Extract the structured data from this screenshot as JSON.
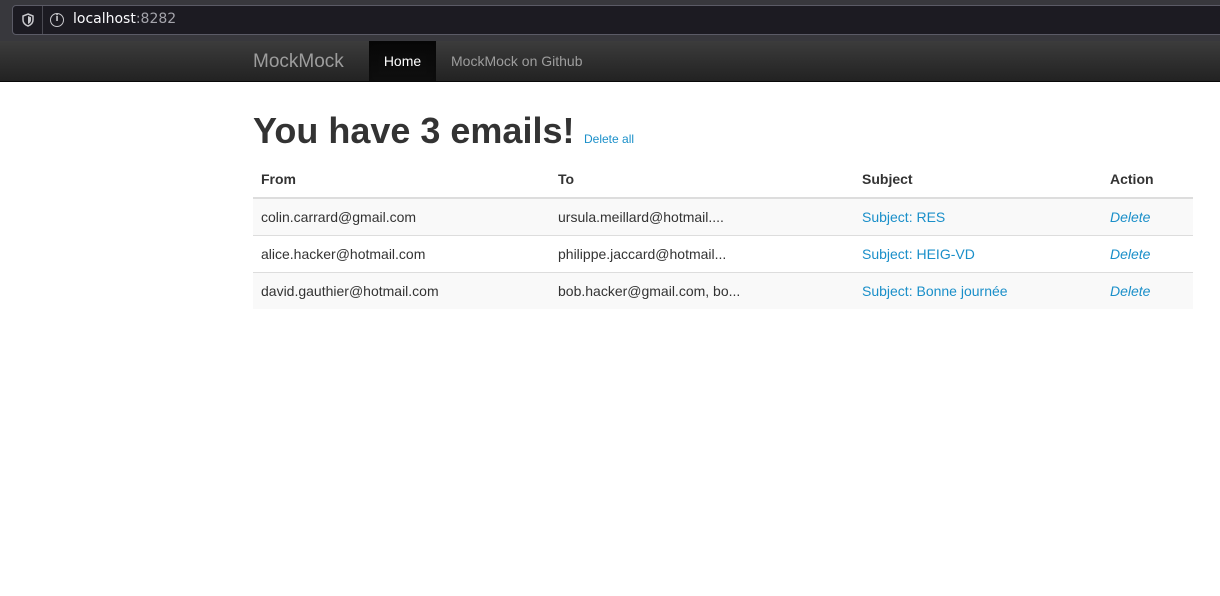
{
  "browser": {
    "url_host": "localhost",
    "url_port": ":8282"
  },
  "navbar": {
    "brand": "MockMock",
    "items": [
      {
        "label": "Home",
        "active": true
      },
      {
        "label": "MockMock on Github",
        "active": false
      }
    ]
  },
  "main": {
    "title": "You have 3 emails!",
    "delete_all_label": "Delete all",
    "table": {
      "headers": [
        "From",
        "To",
        "Subject",
        "Action"
      ],
      "rows": [
        {
          "from": "colin.carrard@gmail.com",
          "to": "ursula.meillard@hotmail....",
          "subject": "Subject: RES",
          "action": "Delete"
        },
        {
          "from": "alice.hacker@hotmail.com",
          "to": "philippe.jaccard@hotmail...",
          "subject": "Subject: HEIG-VD",
          "action": "Delete"
        },
        {
          "from": "david.gauthier@hotmail.com",
          "to": "bob.hacker@gmail.com, bo...",
          "subject": "Subject: Bonne journée",
          "action": "Delete"
        }
      ]
    }
  },
  "colors": {
    "navbar_bg": "#222222",
    "link": "#1a8fc9",
    "striped_row": "#f9f9f9"
  },
  "icons": {
    "tracking": "shield-icon",
    "site_info": "info-icon"
  }
}
